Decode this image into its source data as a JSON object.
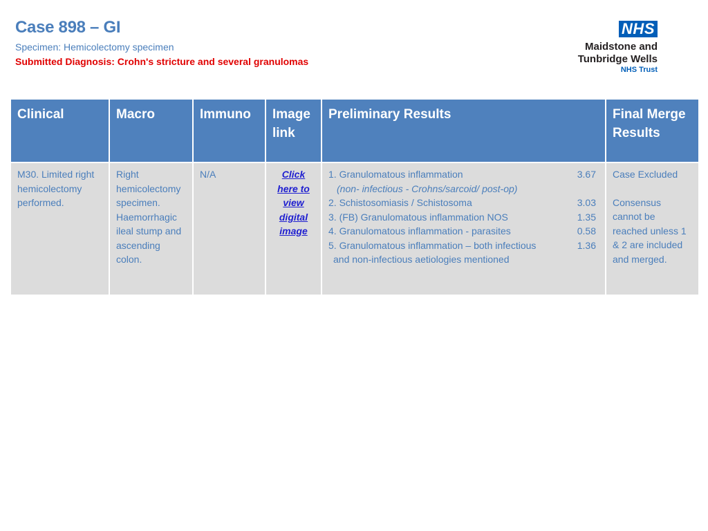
{
  "header": {
    "title": "Case 898 – GI",
    "specimen": "Specimen: Hemicolectomy specimen",
    "diagnosis": "Submitted Diagnosis: Crohn's stricture and several granulomas"
  },
  "logo": {
    "badge": "NHS",
    "line1": "Maidstone and",
    "line2": "Tunbridge Wells",
    "line3": "NHS Trust",
    "color": "#005eb8"
  },
  "table": {
    "headers": {
      "clinical": "Clinical",
      "macro": "Macro",
      "immuno": "Immuno",
      "image_link": "Image link",
      "preliminary": "Preliminary Results",
      "final": "Final Merge Results"
    },
    "row": {
      "clinical": "M30. Limited right hemicolectomy performed.",
      "macro": "Right hemicolectomy specimen. Haemorrhagic ileal stump and ascending colon.",
      "immuno": "N/A",
      "image_link": "Click here to view digital image",
      "preliminary": [
        {
          "label": "1. Granulomatous inflammation",
          "value": "3.67"
        },
        {
          "label": "(non- infectious - Crohns/sarcoid/  post-op)",
          "value": ""
        },
        {
          "label": "2. Schistosomiasis / Schistosoma",
          "value": "3.03"
        },
        {
          "label": "3. (FB) Granulomatous inflammation NOS",
          "value": "1.35"
        },
        {
          "label": "4. Granulomatous inflammation - parasites",
          "value": "0.58"
        },
        {
          "label": "5. Granulomatous inflammation – both infectious",
          "value": "1.36"
        },
        {
          "label": "and non-infectious aetiologies mentioned",
          "value": ""
        }
      ],
      "final_line1": "Case Excluded",
      "final_line2": "Consensus cannot be reached unless 1 & 2 are included and merged."
    }
  },
  "colors": {
    "header_bg": "#4f81bd",
    "cell_bg": "#dcdcdc",
    "title_blue": "#4a7ebb",
    "red": "#e00000"
  }
}
